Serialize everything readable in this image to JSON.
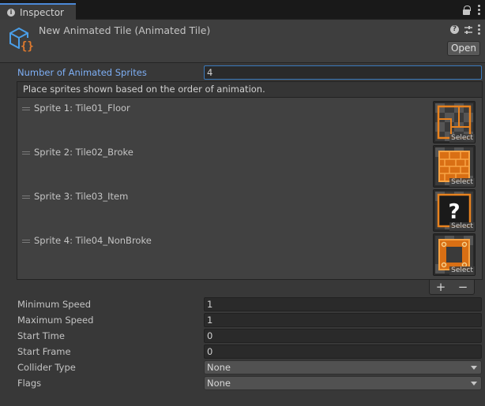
{
  "tab": {
    "label": "Inspector"
  },
  "header": {
    "title": "New Animated Tile (Animated Tile)",
    "open_label": "Open"
  },
  "fields": {
    "num_sprites": {
      "label": "Number of Animated Sprites",
      "value": "4"
    },
    "list_header": "Place sprites shown based on the order of animation.",
    "sprites": [
      {
        "label": "Sprite 1: Tile01_Floor",
        "select": "Select"
      },
      {
        "label": "Sprite 2: Tile02_Broke",
        "select": "Select"
      },
      {
        "label": "Sprite 3: Tile03_Item",
        "select": "Select"
      },
      {
        "label": "Sprite 4: Tile04_NonBroke",
        "select": "Select"
      }
    ],
    "min_speed": {
      "label": "Minimum Speed",
      "value": "1"
    },
    "max_speed": {
      "label": "Maximum Speed",
      "value": "1"
    },
    "start_time": {
      "label": "Start Time",
      "value": "0"
    },
    "start_frame": {
      "label": "Start Frame",
      "value": "0"
    },
    "collider_type": {
      "label": "Collider Type",
      "value": "None"
    },
    "flags": {
      "label": "Flags",
      "value": "None"
    }
  },
  "buttons": {
    "plus": "+",
    "minus": "−"
  },
  "colors": {
    "accent": "#4c89d8",
    "tile_orange": "#e8821e",
    "label_active": "#7eaff5"
  }
}
